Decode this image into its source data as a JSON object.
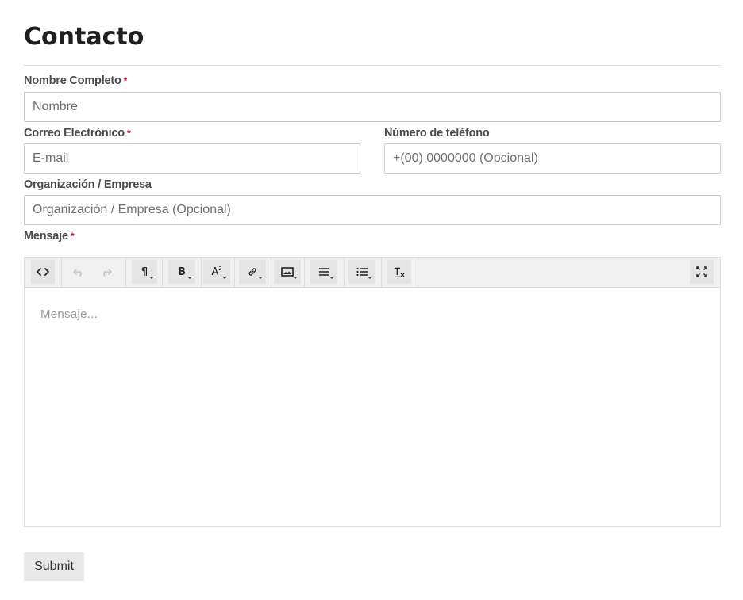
{
  "page": {
    "title": "Contacto"
  },
  "form": {
    "required_mark": "*",
    "name": {
      "label": "Nombre Completo",
      "placeholder": "Nombre"
    },
    "email": {
      "label": "Correo Electrónico",
      "placeholder": "E-mail"
    },
    "phone": {
      "label": "Número de teléfono",
      "placeholder": "+(00) 0000000 (Opcional)"
    },
    "organization": {
      "label": "Organización / Empresa",
      "placeholder": "Organización / Empresa (Opcional)"
    },
    "message": {
      "label": "Mensaje",
      "placeholder": "Mensaje..."
    },
    "submit_label": "Submit"
  },
  "editor": {
    "toolbar_icons": [
      "code-view-icon",
      "undo-icon",
      "redo-icon",
      "paragraph-icon",
      "bold-icon",
      "font-style-icon",
      "link-icon",
      "image-icon",
      "align-icon",
      "list-icon",
      "clear-format-icon",
      "fullscreen-icon"
    ],
    "glyphs": {
      "paragraph": "¶",
      "bold": "B",
      "font_style": "A",
      "font_style_sup": "2"
    }
  },
  "colors": {
    "required": "#d0021b",
    "toolbar_bg": "#f1f1f1",
    "submit_bg": "#e8e8e8",
    "border": "#cccccc"
  }
}
